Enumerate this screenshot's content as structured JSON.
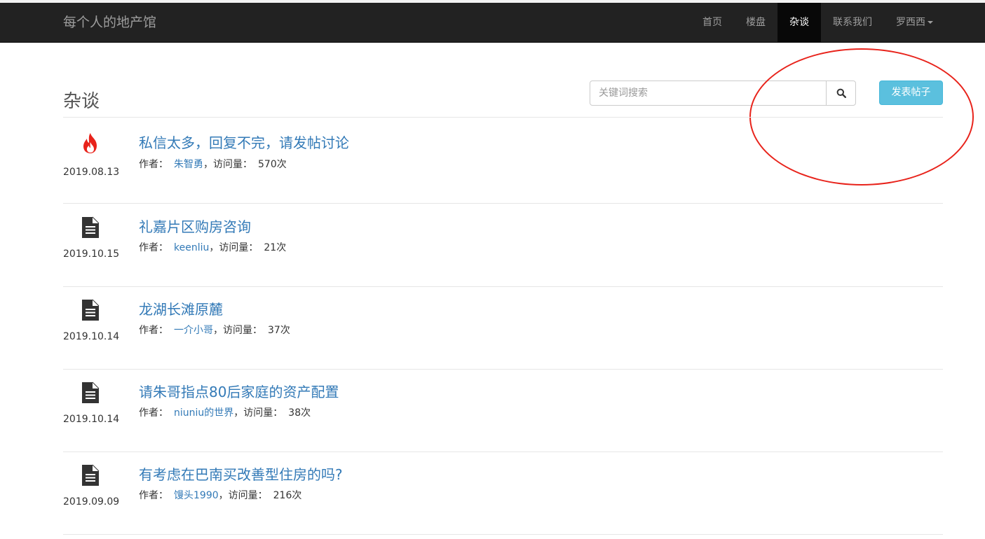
{
  "nav": {
    "brand": "每个人的地产馆",
    "items": [
      {
        "label": "首页",
        "active": false
      },
      {
        "label": "楼盘",
        "active": false
      },
      {
        "label": "杂谈",
        "active": true
      },
      {
        "label": "联系我们",
        "active": false
      },
      {
        "label": "罗西西",
        "active": false,
        "dropdown": true
      }
    ]
  },
  "page": {
    "title": "杂谈",
    "search_placeholder": "关键词搜索",
    "search_icon": "search-icon",
    "post_button": "发表帖子"
  },
  "labels": {
    "author": "作者：",
    "views": "，访问量："
  },
  "colors": {
    "accent_button": "#5bc0de",
    "link": "#337ab7",
    "hot_icon": "#e8231b",
    "annotation": "#e8231b"
  },
  "posts": [
    {
      "icon": "fire-icon",
      "date": "2019.08.13",
      "title": "私信太多，回复不完，请发帖讨论",
      "author": "朱智勇",
      "views": "570次"
    },
    {
      "icon": "document-icon",
      "date": "2019.10.15",
      "title": "礼嘉片区购房咨询",
      "author": "keenliu",
      "views": "21次"
    },
    {
      "icon": "document-icon",
      "date": "2019.10.14",
      "title": "龙湖长滩原麓",
      "author": "一介小哥",
      "views": "37次"
    },
    {
      "icon": "document-icon",
      "date": "2019.10.14",
      "title": "请朱哥指点80后家庭的资产配置",
      "author": "niuniu的世界",
      "views": "38次"
    },
    {
      "icon": "document-icon",
      "date": "2019.09.09",
      "title": "有考虑在巴南买改善型住房的吗?",
      "author": "馒头1990",
      "views": "216次"
    }
  ]
}
